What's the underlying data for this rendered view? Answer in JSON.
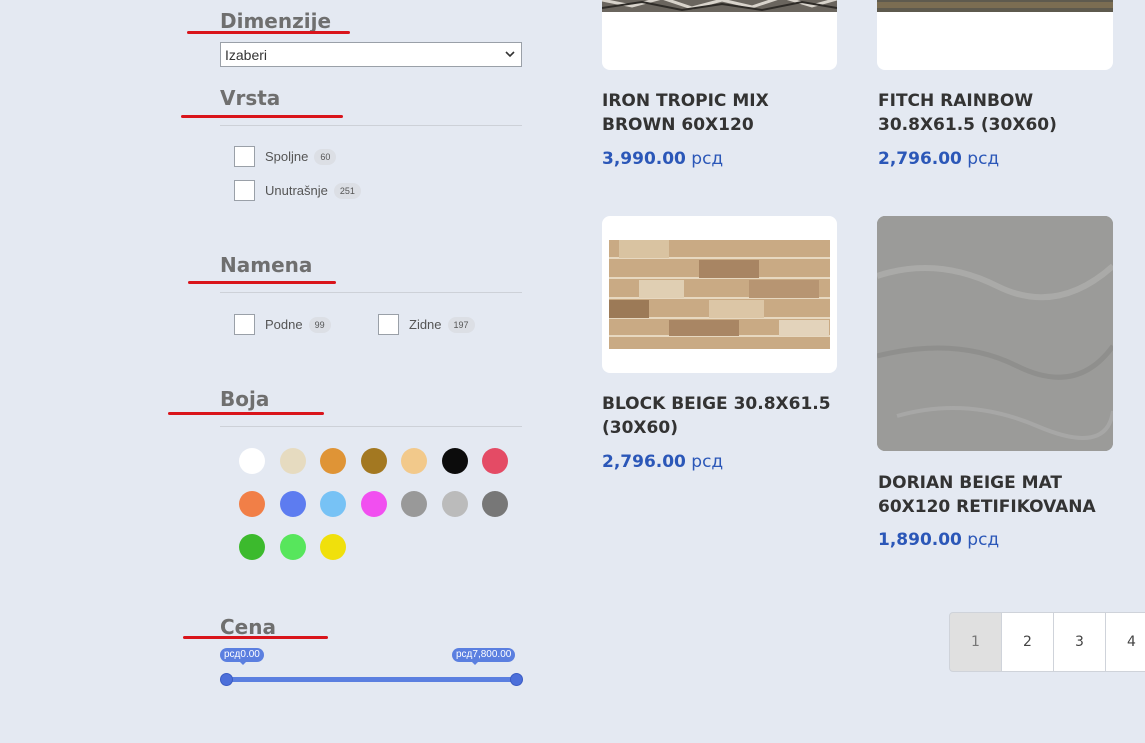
{
  "filters": {
    "dimensions": {
      "title": "Dimenzije",
      "select_value": "Izaberi"
    },
    "type": {
      "title": "Vrsta",
      "options": [
        {
          "label": "Spoljne",
          "count": "60"
        },
        {
          "label": "Unutrašnje",
          "count": "251"
        }
      ]
    },
    "purpose": {
      "title": "Namena",
      "options": [
        {
          "label": "Podne",
          "count": "99"
        },
        {
          "label": "Zidne",
          "count": "197"
        }
      ]
    },
    "color": {
      "title": "Boja",
      "swatches": [
        "#ffffff",
        "#e6dbc0",
        "#df9436",
        "#a37821",
        "#f2c98b",
        "#0c0c0c",
        "#e44b65",
        "#f17f47",
        "#5d7cf0",
        "#77c2f5",
        "#f14ff0",
        "#999999",
        "#bbbbbb",
        "#777777",
        "#3cba2d",
        "#57e65c",
        "#f0e00c"
      ]
    },
    "price": {
      "title": "Cena",
      "min_label": "рсд0.00",
      "max_label": "рсд7,800.00"
    }
  },
  "products": [
    {
      "name_line1": "IRON TROPIC MIX",
      "name_line2": "BROWN 60X120",
      "amount": "3,990.00",
      "currency": "рсд"
    },
    {
      "name_line1": "FITCH RAINBOW",
      "name_line2": "30.8X61.5 (30X60)",
      "amount": "2,796.00",
      "currency": "рсд"
    },
    {
      "name_line1": "BLOCK BEIGE 30.8X61.5",
      "name_line2": "(30X60)",
      "amount": "2,796.00",
      "currency": "рсд"
    },
    {
      "name_line1": "DORIAN BEIGE MAT",
      "name_line2": "60X120 RETIFIKOVANA",
      "amount": "1,890.00",
      "currency": "рсд"
    }
  ],
  "pagination": {
    "pages": [
      "1",
      "2",
      "3",
      "4"
    ],
    "current": "1"
  }
}
